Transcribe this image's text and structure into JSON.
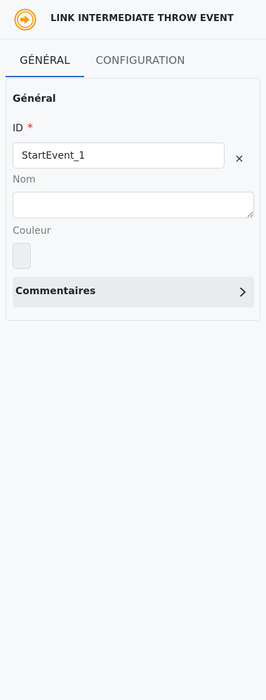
{
  "header": {
    "icon": "link-intermediate-throw-event-icon",
    "icon_color": "#f29d1d",
    "title": "LINK INTERMEDIATE THROW EVENT"
  },
  "tabs": [
    {
      "label": "GÉNÉRAL",
      "active": true
    },
    {
      "label": "CONFIGURATION",
      "active": false
    }
  ],
  "accent_color": "#2a6ecb",
  "general": {
    "section_title": "Général",
    "id": {
      "label": "ID",
      "required_mark": "*",
      "value": "StartEvent_1"
    },
    "name": {
      "label": "Nom",
      "value": ""
    },
    "color": {
      "label": "Couleur"
    },
    "comments": {
      "label": "Commentaires"
    }
  }
}
